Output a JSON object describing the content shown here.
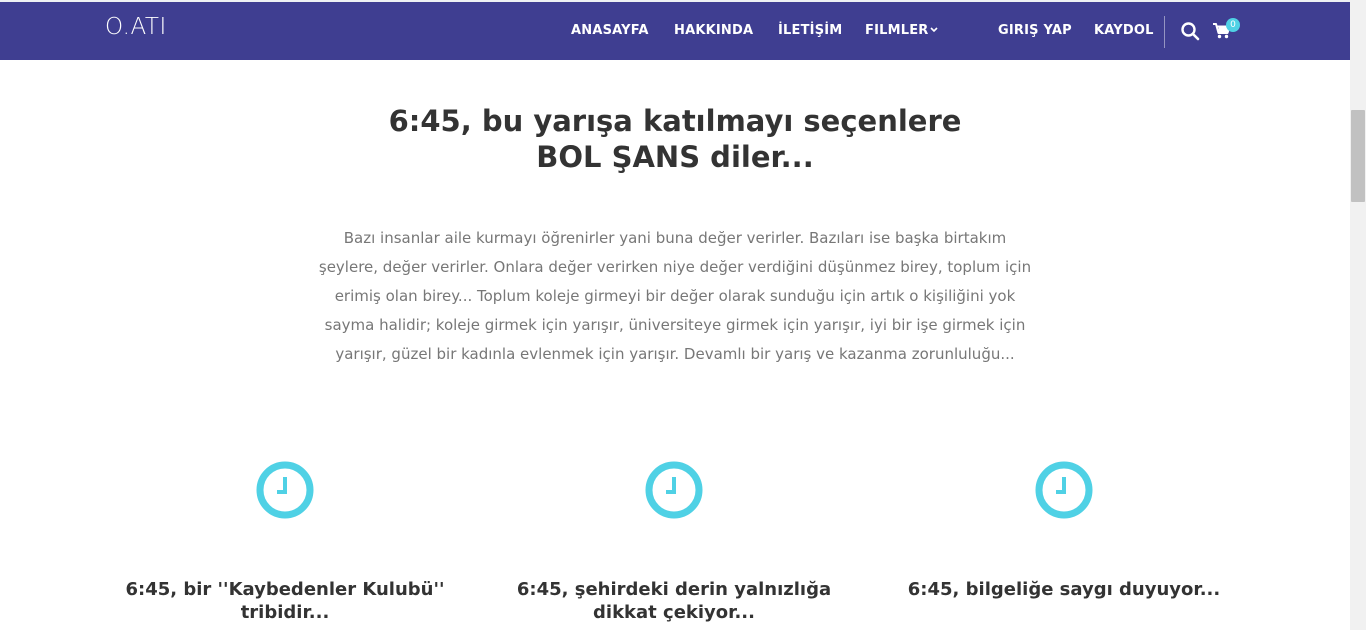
{
  "header": {
    "logo": "O.ATI",
    "nav": {
      "home": "ANASAYFA",
      "about": "HAKKINDA",
      "contact": "İLETİŞİM",
      "films": "FILMLER",
      "login": "GIRIŞ YAP",
      "register": "KAYDOL"
    },
    "cart_count": "0",
    "colors": {
      "navbar": "#3f3e91",
      "accent": "#4fd1e5"
    },
    "icons": [
      "chevron-down-icon",
      "search-icon",
      "cart-icon"
    ]
  },
  "hero": {
    "title_line1": "6:45, bu yarışa katılmayı seçenlere",
    "title_line2": "BOL ŞANS diler...",
    "text_lines": [
      "Bazı insanlar aile kurmayı öğrenirler yani buna değer verirler. Bazıları ise başka birtakım",
      "şeylere, değer verirler. Onlara değer verirken niye değer verdiğini düşünmez birey, toplum için",
      "erimiş olan birey... Toplum koleje girmeyi bir değer olarak sunduğu için artık o kişiliğini yok",
      "sayma halidir; koleje girmek için yarışır, üniversiteye girmek için yarışır, iyi bir işe girmek için",
      "yarışır, güzel bir kadınla evlenmek için yarışır. Devamlı bir yarış ve kazanma zorunluluğu..."
    ]
  },
  "features": [
    {
      "icon": "clock-icon",
      "line1": "6:45, bir ''Kaybedenler Kulubü''",
      "line2": "tribidir..."
    },
    {
      "icon": "clock-icon",
      "line1": "6:45, şehirdeki derin yalnızlığa",
      "line2": "dikkat çekiyor..."
    },
    {
      "icon": "clock-icon",
      "line1": "6:45, bilgeliğe saygı duyuyor...",
      "line2": ""
    }
  ]
}
